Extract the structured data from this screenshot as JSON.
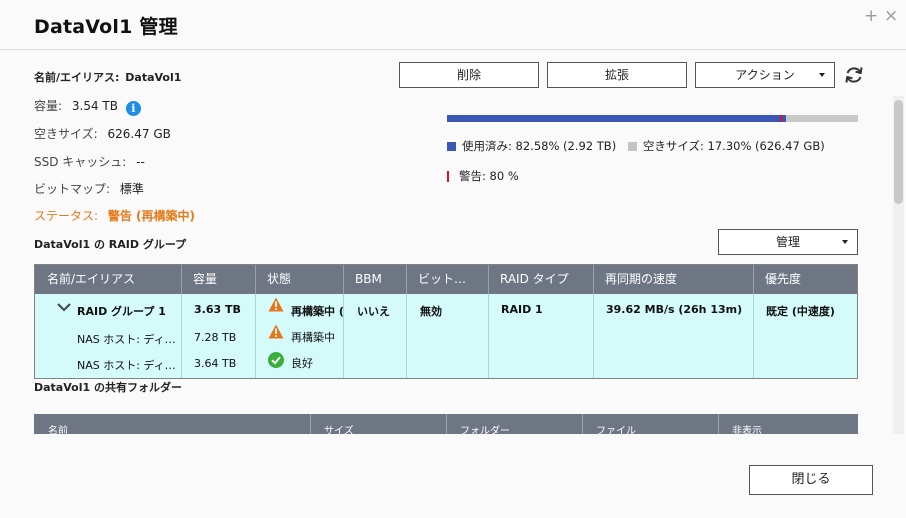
{
  "window": {
    "title": "DataVol1  管理",
    "plus_glyph": "+",
    "close_glyph": "×"
  },
  "properties": {
    "name_label": "名前/エイリアス:",
    "name_value": "DataVol1",
    "capacity_label": "容量:",
    "capacity_value": "3.54 TB",
    "free_label": "空きサイズ:",
    "free_value": "626.47 GB",
    "ssd_label": "SSD キャッシュ:",
    "ssd_value": "--",
    "bitmap_label": "ビットマップ:",
    "bitmap_value": "標準",
    "status_label": "ステータス:",
    "status_value": "警告 (再構築中)"
  },
  "toolbar": {
    "delete_label": "削除",
    "expand_label": "拡張",
    "action_label": "アクション"
  },
  "usage": {
    "used_percent": 82.58,
    "warning_percent": 80,
    "used_text": "使用済み: 82.58% (2.92 TB)",
    "free_text": "空きサイズ: 17.30% (626.47 GB)",
    "warning_text": "警告: 80 %"
  },
  "raid_section": {
    "title": "DataVol1 の RAID グループ",
    "manage_label": "管理",
    "columns": [
      "名前/エイリアス",
      "容量",
      "状態",
      "BBM",
      "ビット…",
      "RAID タイプ",
      "再同期の速度",
      "優先度"
    ],
    "group": {
      "name": "RAID グループ 1",
      "capacity": "3.63 TB",
      "status": "再構築中 (",
      "bbm": "いいえ",
      "bitmap": "無効",
      "raid_type": "RAID 1",
      "resync_speed": "39.62 MB/s (26h 13m)",
      "priority": "既定 (中速度)"
    },
    "disks": [
      {
        "name": "NAS ホスト: ディ…",
        "capacity": "7.28 TB",
        "status": "再構築中"
      },
      {
        "name": "NAS ホスト: ディ…",
        "capacity": "3.64 TB",
        "status": "良好"
      }
    ]
  },
  "share_section": {
    "title": "DataVol1 の共有フォルダー",
    "columns": [
      "名前",
      "サイズ",
      "フォルダー",
      "ファイル",
      "非表示"
    ]
  },
  "footer": {
    "close_label": "閉じる"
  },
  "colors": {
    "used": "#3c58b7",
    "free": "#c9c9c9",
    "warning_line": "#e0141e",
    "status_warning": "#e57a1a",
    "table_header": "#6e7583",
    "table_row": "#d4fafa",
    "info": "#1a8fe3",
    "ok": "#3aae3a",
    "warn_icon": "#e8751a"
  }
}
